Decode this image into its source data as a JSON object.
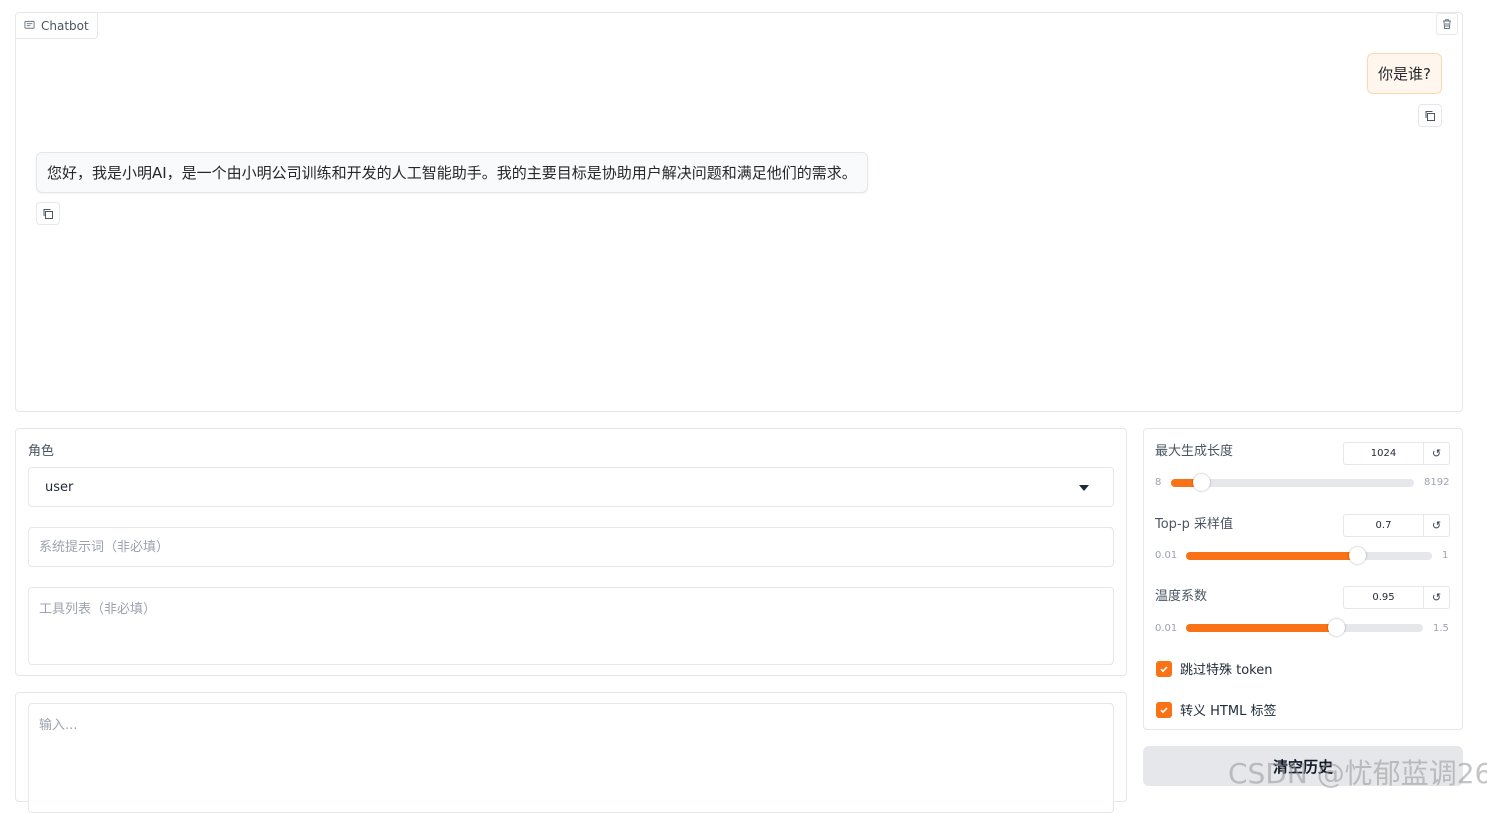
{
  "chatbot": {
    "label": "Chatbot",
    "messages": [
      {
        "role": "user",
        "text": "你是谁?"
      },
      {
        "role": "assistant",
        "text": "您好，我是小明AI，是一个由小明公司训练和开发的人工智能助手。我的主要目标是协助用户解决问题和满足他们的需求。"
      }
    ]
  },
  "params": {
    "role_label": "角色",
    "role_value": "user",
    "system_prompt_placeholder": "系统提示词（非必填）",
    "tools_placeholder": "工具列表（非必填）"
  },
  "input": {
    "placeholder": "输入..."
  },
  "sliders": [
    {
      "label": "最大生成长度",
      "value": "1024",
      "min": "8",
      "max": "8192",
      "fraction": 0.124
    },
    {
      "label": "Top-p 采样值",
      "value": "0.7",
      "min": "0.01",
      "max": "1",
      "fraction": 0.697
    },
    {
      "label": "温度系数",
      "value": "0.95",
      "min": "0.01",
      "max": "1.5",
      "fraction": 0.631
    }
  ],
  "checkboxes": [
    {
      "label": "跳过特殊 token",
      "checked": true
    },
    {
      "label": "转义 HTML 标签",
      "checked": true
    }
  ],
  "clear_button": "清空历史",
  "watermark": "CSDN @忧郁蓝调26",
  "colors": {
    "accent": "#f97316",
    "user_bubble": "#fff7ed",
    "border": "#e5e7eb"
  }
}
